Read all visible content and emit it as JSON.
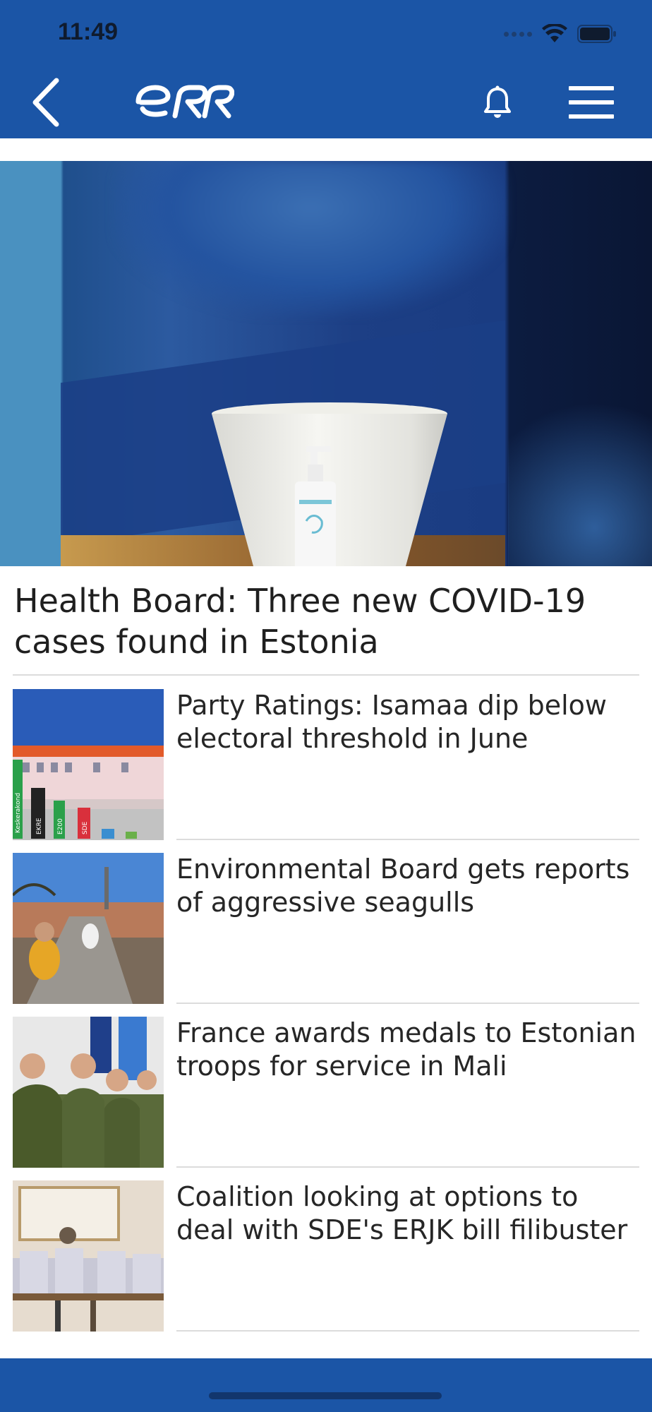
{
  "status_bar": {
    "time": "11:49"
  },
  "header": {
    "logo_text": "ERR",
    "brand_color": "#1b55a6"
  },
  "lead_article": {
    "title": "Health Board: Three new COVID-19 cases found in Estonia"
  },
  "articles": [
    {
      "title": "Party Ratings: Isamaa dip below electoral threshold in June",
      "thumb_bar_labels": [
        "Keskerakond",
        "EKRE",
        "E200",
        "SDE"
      ]
    },
    {
      "title": "Environmental Board gets reports of aggressive seagulls"
    },
    {
      "title": "France awards medals to Estonian troops for service in Mali"
    },
    {
      "title": "Coalition looking at options to deal with SDE's ERJK bill filibuster"
    }
  ]
}
